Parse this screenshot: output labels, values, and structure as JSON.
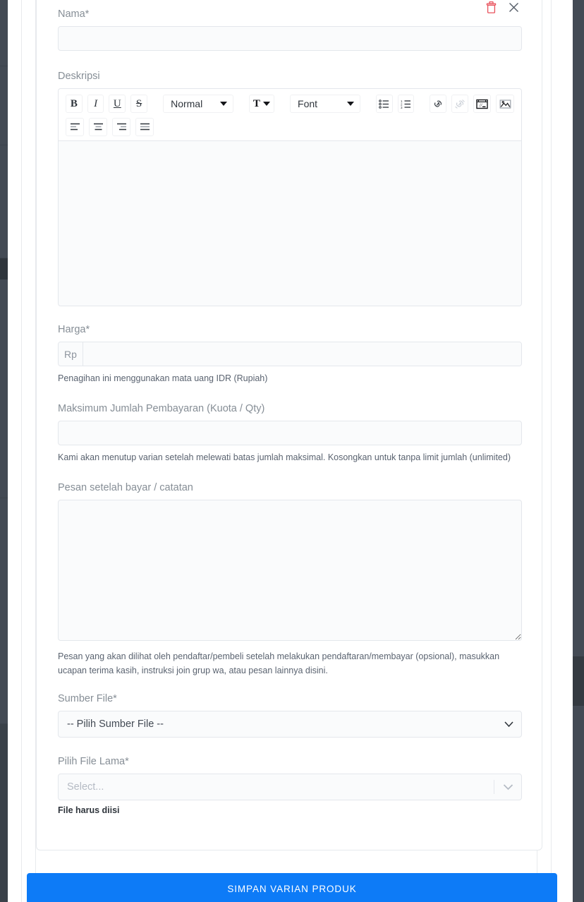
{
  "modal": {
    "name_field": {
      "label": "Nama*",
      "value": "",
      "placeholder": ""
    },
    "header_actions": [
      {
        "name": "delete-variant-button",
        "icon": "trash-icon",
        "color": "#e8505b"
      },
      {
        "name": "close-modal-button",
        "icon": "close-icon",
        "color": "#5a6370"
      }
    ],
    "description_field": {
      "label": "Deskripsi",
      "value": "",
      "placeholder": "",
      "toolbar": {
        "row1": [
          {
            "name": "bold-button",
            "icon": "bold-icon",
            "label": "B"
          },
          {
            "name": "italic-button",
            "icon": "italic-icon",
            "label": "I"
          },
          {
            "name": "underline-button",
            "icon": "underline-icon",
            "label": "U"
          },
          {
            "name": "strikethrough-button",
            "icon": "strikethrough-icon",
            "label": "S"
          }
        ],
        "header_select": {
          "name": "header-size-select",
          "value": "Normal"
        },
        "color_button": {
          "name": "text-color-button",
          "icon": "text-color-icon",
          "label": "T"
        },
        "font_select": {
          "name": "font-family-select",
          "value": "Font"
        },
        "list_buttons": [
          {
            "name": "bullet-list-button",
            "icon": "bullet-list-icon"
          },
          {
            "name": "ordered-list-button",
            "icon": "ordered-list-icon"
          }
        ],
        "media_buttons": [
          {
            "name": "insert-link-button",
            "icon": "link-icon",
            "disabled": false
          },
          {
            "name": "remove-link-button",
            "icon": "unlink-icon",
            "disabled": true
          },
          {
            "name": "insert-video-button",
            "icon": "video-icon",
            "disabled": false
          },
          {
            "name": "insert-image-button",
            "icon": "image-icon",
            "disabled": false
          }
        ],
        "align_buttons": [
          {
            "name": "align-left-button",
            "icon": "align-left-icon"
          },
          {
            "name": "align-center-button",
            "icon": "align-center-icon"
          },
          {
            "name": "align-right-button",
            "icon": "align-right-icon"
          },
          {
            "name": "align-justify-button",
            "icon": "align-justify-icon"
          }
        ]
      }
    },
    "price_field": {
      "label": "Harga*",
      "currency_addon": "Rp",
      "value": "",
      "placeholder": "",
      "help": "Penagihan ini menggunakan mata uang IDR (Rupiah)"
    },
    "quota_field": {
      "label": "Maksimum Jumlah Pembayaran (Kuota / Qty)",
      "value": "",
      "placeholder": "",
      "help": "Kami akan menutup varian setelah melewati batas jumlah maksimal. Kosongkan untuk tanpa limit jumlah (unlimited)"
    },
    "message_field": {
      "label": "Pesan setelah bayar / catatan",
      "value": "",
      "placeholder": "",
      "help": "Pesan yang akan dilihat oleh pendaftar/pembeli setelah melakukan pendaftaran/membayar (opsional), masukkan ucapan terima kasih, instruksi join grup wa, atau pesan lainnya disini."
    },
    "source_field": {
      "label": "Sumber File*",
      "selected": "-- Pilih Sumber File --",
      "options": [
        "-- Pilih Sumber File --"
      ]
    },
    "file_field": {
      "label": "Pilih File Lama*",
      "placeholder": "Select...",
      "error": "File harus diisi"
    }
  },
  "footer": {
    "submit_label": "SIMPAN VARIAN PRODUK",
    "submit_color": "#0d7bf7"
  }
}
